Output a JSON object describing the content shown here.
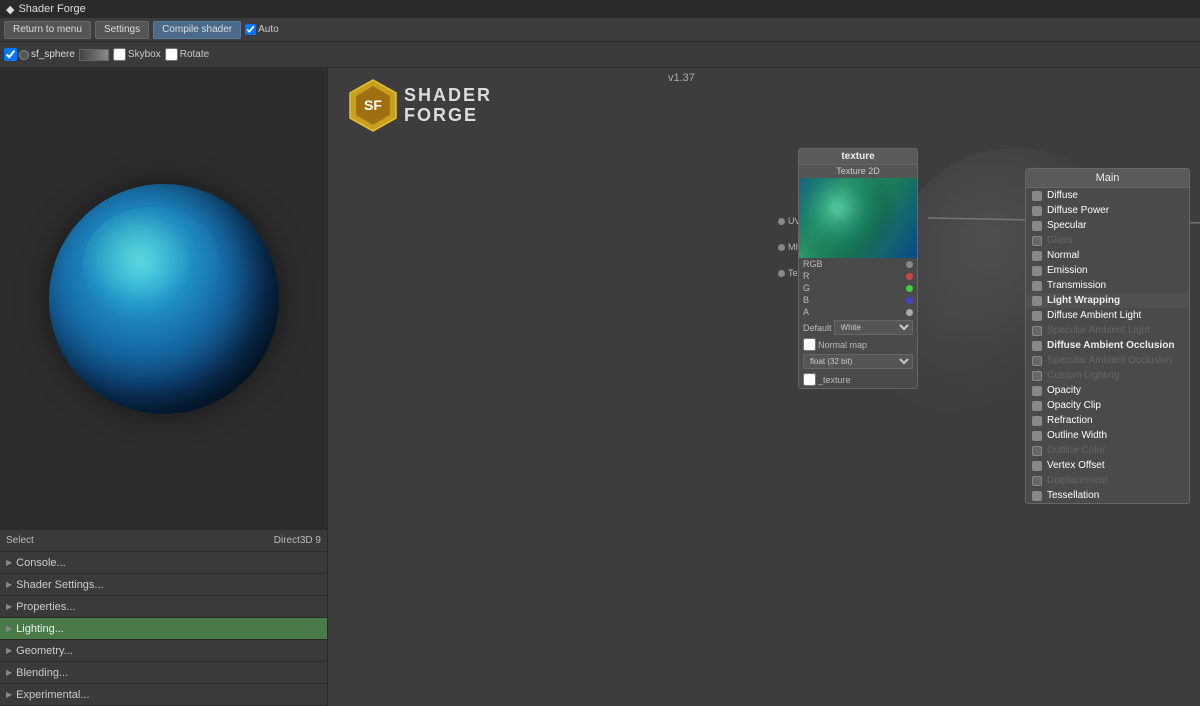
{
  "titleBar": {
    "icon": "shader-forge-icon",
    "title": "Shader Forge"
  },
  "toolbar": {
    "returnToMenuLabel": "Return to menu",
    "settingsLabel": "Settings",
    "compileShaderLabel": "Compile shader",
    "autoLabel": "Auto",
    "autoChecked": true
  },
  "objectBar": {
    "checkboxLabel": "sf_sphere",
    "dotColor": "#888",
    "skyboxLabel": "Skybox",
    "skyboxChecked": false,
    "rotateLabel": "Rotate",
    "rotateChecked": false
  },
  "version": "v1.37",
  "canvas": {
    "sfLogoText": "SHADER\nFORGE"
  },
  "textureNode": {
    "title": "texture",
    "subtitle": "Texture 2D",
    "inputs": [
      "UV",
      "MIP",
      "Tex"
    ],
    "outputs": [
      "RGB",
      "R",
      "G",
      "B",
      "A"
    ],
    "defaultLabel": "Default",
    "defaultValue": "White",
    "normalMapLabel": "Normal map",
    "normalMapChecked": false,
    "formatLabel": "float (32 bit)",
    "nameLabel": "_texture"
  },
  "mainPanel": {
    "title": "Main",
    "items": [
      {
        "label": "Diffuse",
        "active": true,
        "dimmed": false
      },
      {
        "label": "Diffuse Power",
        "active": true,
        "dimmed": false
      },
      {
        "label": "Specular",
        "active": true,
        "dimmed": false
      },
      {
        "label": "Gloss",
        "active": false,
        "dimmed": true
      },
      {
        "label": "Normal",
        "active": true,
        "dimmed": false
      },
      {
        "label": "Emission",
        "active": true,
        "dimmed": false
      },
      {
        "label": "Transmission",
        "active": true,
        "dimmed": false
      },
      {
        "label": "Light Wrapping",
        "active": true,
        "dimmed": false,
        "highlighted": true
      },
      {
        "label": "Diffuse Ambient Light",
        "active": true,
        "dimmed": false
      },
      {
        "label": "Specular Ambient Light",
        "active": false,
        "dimmed": true
      },
      {
        "label": "Diffuse Ambient Occlusion",
        "active": true,
        "dimmed": false,
        "bold": true
      },
      {
        "label": "Specular Ambient Occlusion",
        "active": false,
        "dimmed": true
      },
      {
        "label": "Custom Lighting",
        "active": false,
        "dimmed": true
      },
      {
        "label": "Opacity",
        "active": true,
        "dimmed": false
      },
      {
        "label": "Opacity Clip",
        "active": true,
        "dimmed": false
      },
      {
        "label": "Refraction",
        "active": true,
        "dimmed": false
      },
      {
        "label": "Outline Width",
        "active": true,
        "dimmed": false
      },
      {
        "label": "Outline Color",
        "active": false,
        "dimmed": true
      },
      {
        "label": "Vertex Offset",
        "active": true,
        "dimmed": false
      },
      {
        "label": "Displacement",
        "active": false,
        "dimmed": true
      },
      {
        "label": "Tessellation",
        "active": true,
        "dimmed": false
      }
    ]
  },
  "selectBar": {
    "selectLabel": "Select",
    "renderLabel": "Direct3D 9"
  },
  "menuItems": [
    {
      "label": "Console...",
      "active": false
    },
    {
      "label": "Shader Settings...",
      "active": false
    },
    {
      "label": "Properties...",
      "active": false
    },
    {
      "label": "Lighting...",
      "active": true
    },
    {
      "label": "Geometry...",
      "active": false
    },
    {
      "label": "Blending...",
      "active": false
    },
    {
      "label": "Experimental...",
      "active": false
    }
  ]
}
